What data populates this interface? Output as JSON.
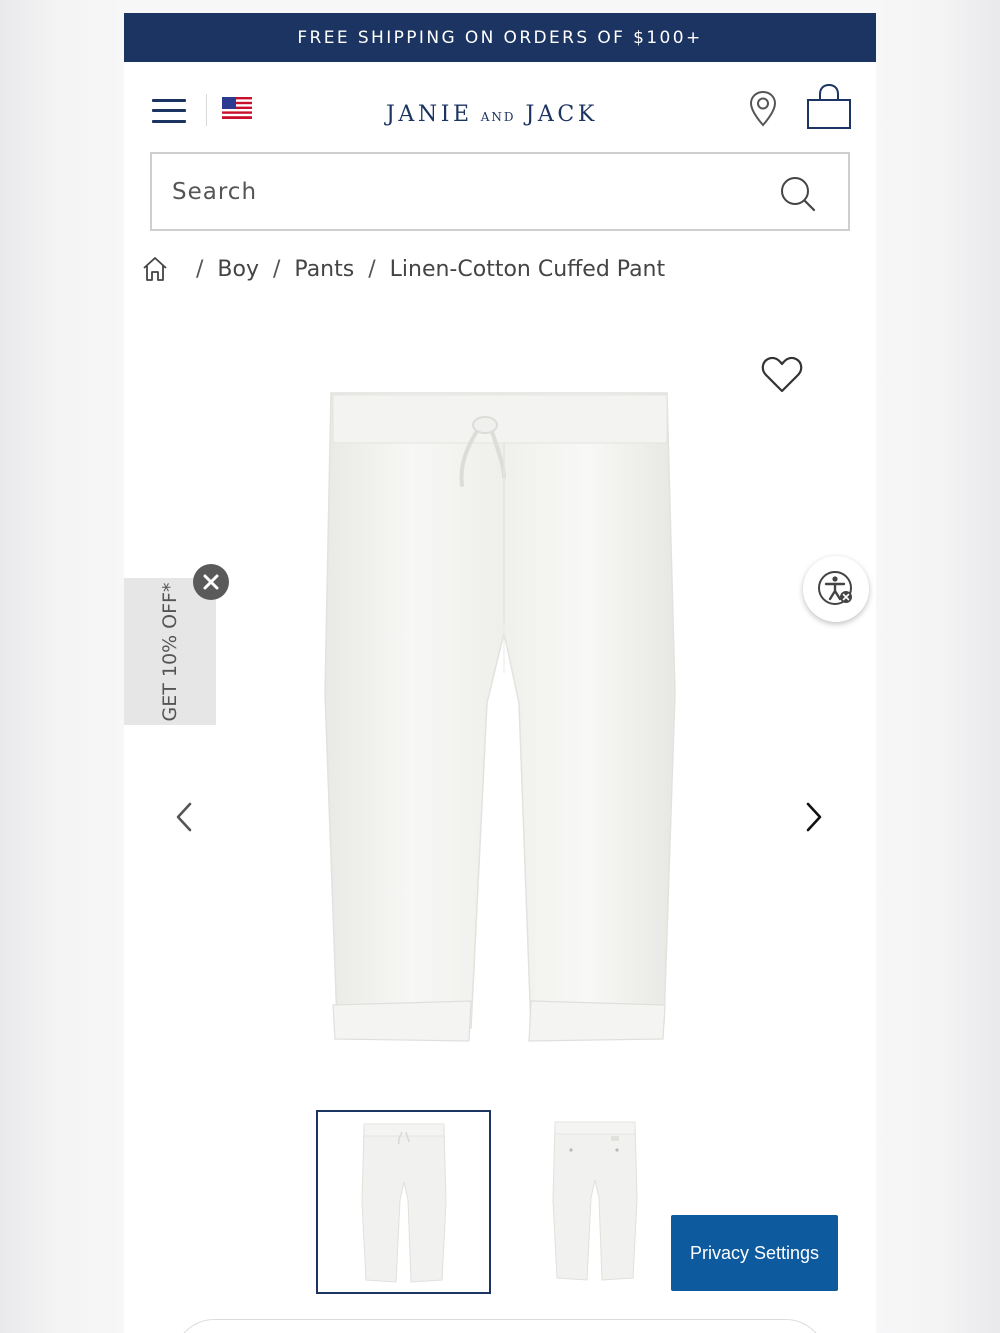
{
  "promo": {
    "text": "FREE SHIPPING ON ORDERS OF $100+"
  },
  "header": {
    "logo": {
      "part1": "JANIE",
      "part2": "AND",
      "part3": "JACK"
    },
    "icons": [
      "menu-icon",
      "us-flag-icon",
      "location-pin-icon",
      "shopping-bag-icon"
    ]
  },
  "search": {
    "placeholder": "Search"
  },
  "breadcrumb": {
    "separator": "/",
    "items": [
      "Boy",
      "Pants",
      "Linen-Cotton Cuffed Pant"
    ]
  },
  "offer": {
    "label": "GET 10% OFF*"
  },
  "privacy": {
    "label": "Privacy Settings"
  },
  "colors": {
    "brand_navy": "#1c3461",
    "privacy_blue": "#0e5a9e",
    "offer_tab": "#e6e6e6"
  }
}
